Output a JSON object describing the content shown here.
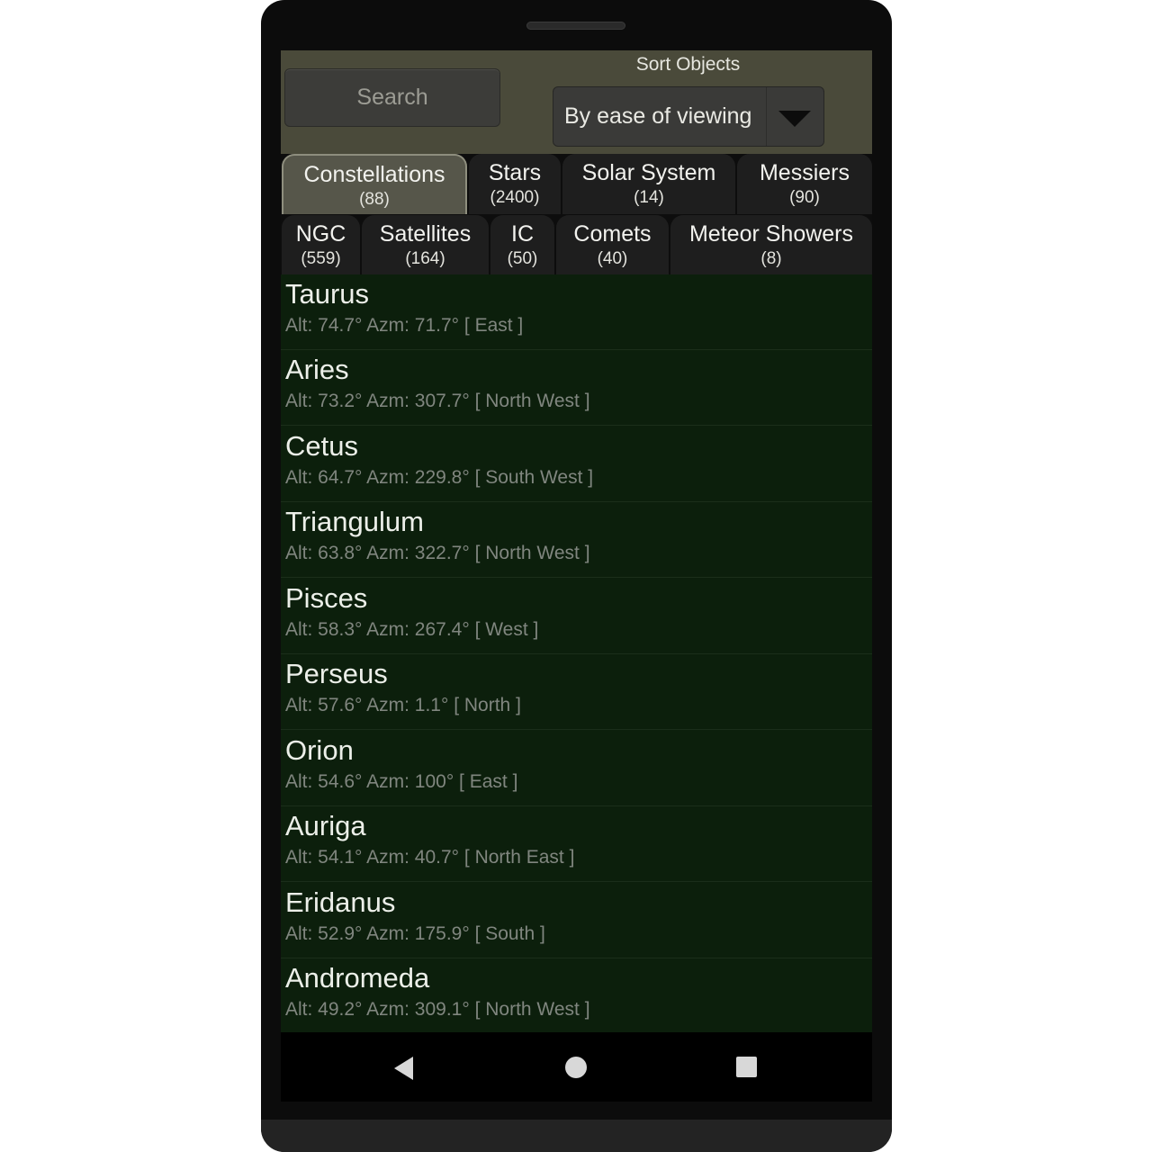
{
  "header": {
    "search_label": "Search",
    "sort_label": "Sort Objects",
    "sort_value": "By ease of viewing",
    "dropdown_icon": "chevron-down-icon"
  },
  "tabs_row1": [
    {
      "label": "Constellations",
      "count": "(88)",
      "active": true
    },
    {
      "label": "Stars",
      "count": "(2400)",
      "active": false
    },
    {
      "label": "Solar System",
      "count": "(14)",
      "active": false
    },
    {
      "label": "Messiers",
      "count": "(90)",
      "active": false
    }
  ],
  "tabs_row2": [
    {
      "label": "NGC",
      "count": "(559)",
      "active": false
    },
    {
      "label": "Satellites",
      "count": "(164)",
      "active": false
    },
    {
      "label": "IC",
      "count": "(50)",
      "active": false
    },
    {
      "label": "Comets",
      "count": "(40)",
      "active": false
    },
    {
      "label": "Meteor Showers",
      "count": "(8)",
      "active": false
    }
  ],
  "objects": [
    {
      "name": "Taurus",
      "position": "Alt: 74.7° Azm: 71.7° [ East ]"
    },
    {
      "name": "Aries",
      "position": "Alt: 73.2° Azm: 307.7° [ North West ]"
    },
    {
      "name": "Cetus",
      "position": "Alt: 64.7° Azm: 229.8° [ South West ]"
    },
    {
      "name": "Triangulum",
      "position": "Alt: 63.8° Azm: 322.7° [ North West ]"
    },
    {
      "name": "Pisces",
      "position": "Alt: 58.3° Azm: 267.4° [ West ]"
    },
    {
      "name": "Perseus",
      "position": "Alt: 57.6° Azm: 1.1° [ North ]"
    },
    {
      "name": "Orion",
      "position": "Alt: 54.6° Azm: 100° [ East ]"
    },
    {
      "name": "Auriga",
      "position": "Alt: 54.1° Azm: 40.7° [ North East ]"
    },
    {
      "name": "Eridanus",
      "position": "Alt: 52.9° Azm: 175.9° [ South ]"
    },
    {
      "name": "Andromeda",
      "position": "Alt: 49.2° Azm: 309.1° [ North West ]"
    }
  ],
  "navbar": {
    "back_icon": "back-triangle-icon",
    "home_icon": "home-circle-icon",
    "recents_icon": "recents-square-icon"
  },
  "colors": {
    "header_bg": "#4a4a3a",
    "list_bg": "#0c1f0c",
    "active_tab_bg": "#56564a",
    "tab_bg": "#1e1e1e"
  }
}
